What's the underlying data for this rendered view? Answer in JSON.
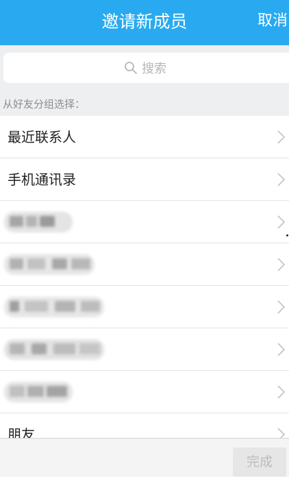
{
  "header": {
    "title": "邀请新成员",
    "cancel_label": "取消"
  },
  "search": {
    "placeholder": "搜索",
    "icon": "search-icon"
  },
  "section": {
    "label": "从好友分组选择："
  },
  "list": {
    "items": [
      {
        "label": "最近联系人"
      },
      {
        "label": "手机通讯录"
      },
      {
        "label": ""
      },
      {
        "label": ""
      },
      {
        "label": ""
      },
      {
        "label": ""
      },
      {
        "label": ""
      },
      {
        "label": "朋友"
      }
    ]
  },
  "footer": {
    "done_label": "完成"
  },
  "colors": {
    "accent": "#29aaf0",
    "background_gray": "#eeeff1",
    "text": "#222222",
    "muted": "#8d8d8d"
  }
}
